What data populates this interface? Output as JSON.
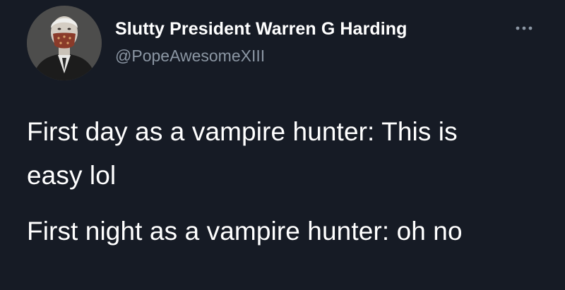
{
  "tweet": {
    "author": {
      "display_name": "Slutty President Warren G Harding",
      "handle": "@PopeAwesomeXIII",
      "avatar_icon": "user-avatar-photo"
    },
    "more_icon": "more-options-icon",
    "text_lines": [
      "First day as a vampire hunter: This is",
      "easy lol",
      "First night as a vampire hunter: oh no"
    ]
  },
  "colors": {
    "background": "#161b25",
    "primary_text": "#ffffff",
    "secondary_text": "#8b96a3"
  }
}
